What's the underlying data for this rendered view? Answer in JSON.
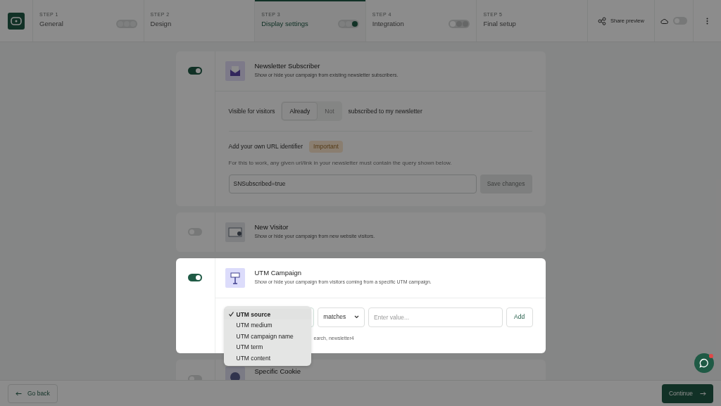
{
  "steps": [
    {
      "step": "STEP 1",
      "label": "General",
      "selected": false,
      "dots": [
        {
          "color": "#7e7f7f"
        },
        {
          "color": "#7e7f7f"
        },
        {
          "color": "#7e7f7f"
        }
      ]
    },
    {
      "step": "STEP 2",
      "label": "Design",
      "selected": false
    },
    {
      "step": "STEP 3",
      "label": "Display settings",
      "selected": true,
      "dots": [
        {
          "color": "#7e7f7f"
        },
        {
          "color": "#7e7f7f"
        },
        {
          "color": "#113226"
        }
      ]
    },
    {
      "step": "STEP 4",
      "label": "Integration",
      "selected": false,
      "dots": [
        {
          "color": "#8c8c8c"
        },
        {
          "color": "#666767"
        },
        {
          "color": "#666767"
        }
      ]
    },
    {
      "step": "STEP 5",
      "label": "Final setup",
      "selected": false
    }
  ],
  "share": {
    "label": "Share preview"
  },
  "cloud_toggle": {
    "on": false
  },
  "cards": [
    {
      "kind": "newsletter",
      "title": "Newsletter Subscriber",
      "description": "Show or hide your campaign from existing newsletter subscribers.",
      "on": true,
      "highlighted": false,
      "visible_label": "Visible for visitors",
      "segments": [
        {
          "label": "Already",
          "selected": true
        },
        {
          "label": "Not",
          "selected": false
        }
      ],
      "visible_suffix": "subscribed to my newsletter",
      "url_title": "Add your own URL identifier",
      "badge": "Important",
      "hint": "For this to work, any given url/link in your newsletter must contain the query shown below.",
      "value": "SNSubscribed=true",
      "save": {
        "label": "Save changes",
        "disabled": true
      }
    },
    {
      "kind": "visitor",
      "title": "New Visitor",
      "description": "Show or hide your campaign from new website visitors.",
      "on": false,
      "highlighted": false
    },
    {
      "kind": "utm",
      "title": "UTM Campaign",
      "description": "Show or hide your campaign from visitors coming from a specific UTM campaign.",
      "on": true,
      "highlighted": true,
      "operator": "matches",
      "placeholder": "Enter value...",
      "add": "Add",
      "helper": "earch, newsletter4",
      "menu": [
        {
          "label": "UTM source",
          "selected": true
        },
        {
          "label": "UTM medium",
          "selected": false
        },
        {
          "label": "UTM campaign name",
          "selected": false
        },
        {
          "label": "UTM term",
          "selected": false
        },
        {
          "label": "UTM content",
          "selected": false
        }
      ]
    },
    {
      "kind": "cookie",
      "title": "Specific Cookie",
      "on": false,
      "highlighted": false
    }
  ],
  "footer": {
    "back": "Go back",
    "continue": "Continue"
  },
  "chat": {
    "unread": true
  }
}
